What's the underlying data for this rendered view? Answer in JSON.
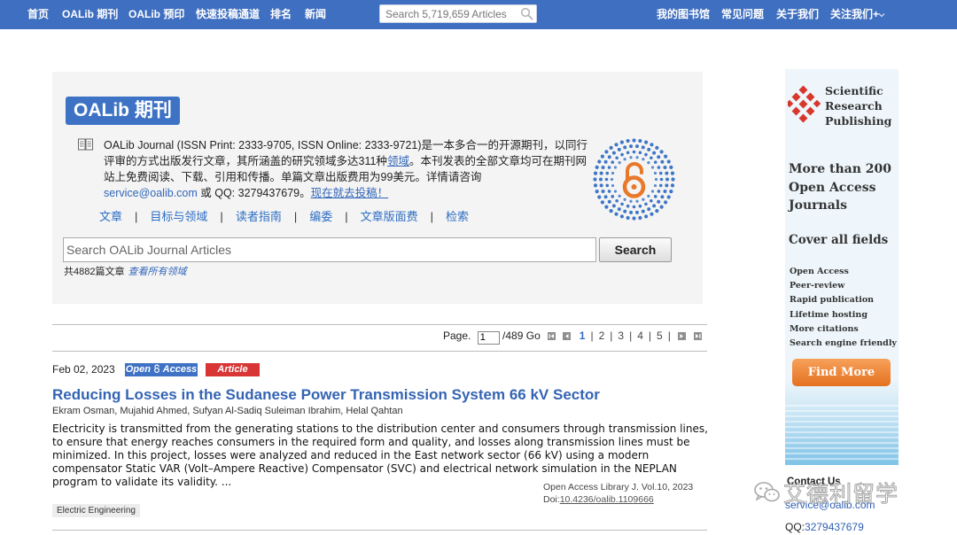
{
  "nav": {
    "left": [
      "首页",
      "OALib 期刊",
      "OALib 预印",
      "快速投稿通道",
      "排名",
      "新闻"
    ],
    "search_placeholder": "Search 5,719,659 Articles",
    "right": [
      "我的图书馆",
      "常见问题",
      "关于我们",
      "关注我们+"
    ]
  },
  "journal": {
    "brand": "OALib 期刊",
    "description_lead": "OALib Journal (ISSN Print: 2333-9705, ISSN Online: 2333-9721)是一本多合一的开源期刊，以同行评审的方式出版发行文章，其所涵盖的研究领域多达311种",
    "fields_link": "领域",
    "description_mid": "。本刊发表的全部文章均可在期刊网站上免费阅读、下载、引用和传播。单篇文章出版费用为99美元。详情请咨询",
    "email": "service@oalib.com",
    "qq_lead": " 或 QQ: 3279437679。",
    "submit_link": "现在就去投稿！",
    "subnav": [
      "文章",
      "目标与领域",
      "读者指南",
      "编委",
      "文章版面费",
      "检索"
    ],
    "search_placeholder": "Search OALib Journal Articles",
    "search_button": "Search",
    "count_text": "共4882篇文章",
    "all_fields_link": "查看所有领域"
  },
  "pagination": {
    "label": "Page.",
    "current": "1",
    "total": "/489 Go",
    "pages": [
      "1",
      "2",
      "3",
      "4",
      "5"
    ]
  },
  "article": {
    "date": "Feb 02, 2023",
    "oa_badge_1": "Open",
    "oa_badge_2": "Access",
    "type_badge": "Article",
    "title": "Reducing Losses in the Sudanese Power Transmission System 66 kV Sector",
    "authors": "Ekram Osman, Mujahid Ahmed, Sufyan Al-Sadiq Suleiman Ibrahim, Helal Qahtan",
    "abstract": "Electricity is transmitted from the generating stations to the distribution center and consumers through transmission lines, to ensure that energy reaches consumers in the required form and quality, and losses along transmission lines must be minimized. In this project, losses were analyzed and reduced in the East network sector (66 kV) using a modern compensator Static VAR (Volt–Ampere Reactive) Compensator (SVC) and electrical network simulation in the NEPLAN program to validate its validity. ...",
    "journal_line": "Open Access Library J.   Vol.10, 2023",
    "doi_label": "Doi:",
    "doi": "10.4236/oalib.1109666",
    "field_tag": "Electric Engineering"
  },
  "ad": {
    "brand_lines": [
      "Scientific",
      "Research",
      "Publishing"
    ],
    "headline_lines": [
      "More than 200",
      "Open Access",
      "Journals"
    ],
    "cover": "Cover all fields",
    "features": [
      "Open Access",
      "Peer-review",
      "Rapid publication",
      "Lifetime hosting",
      "More citations",
      "Search engine friendly"
    ],
    "button": "Find More",
    "accent_color": "#e8782a"
  },
  "contact": {
    "title": "Contact Us",
    "email": "service@oalib.com",
    "qq_label": "QQ:",
    "qq": "3279437679"
  },
  "watermark": {
    "text": "艾德利留学"
  },
  "colors": {
    "nav_bg": "#3f6fc0",
    "link_blue": "#3166b8",
    "article_badge_red": "#d93535"
  }
}
